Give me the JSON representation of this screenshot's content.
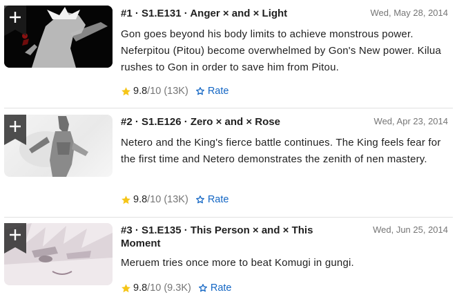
{
  "episodes": [
    {
      "title": "#1 · S1.E131 · Anger × and × Light",
      "date": "Wed, May 28, 2014",
      "plot": "Gon goes beyond his body limits to achieve monstrous power. Neferpitou (Pitou) become overwhelmed by Gon's New power. Kilua rushes to Gon in order to save him from Pitou.",
      "rating": "9.8",
      "rating_max": "/10",
      "votes": "(13K)",
      "rate_label": "Rate",
      "add_symbol": "+"
    },
    {
      "title": "#2 · S1.E126 · Zero × and × Rose",
      "date": "Wed, Apr 23, 2014",
      "plot": "Netero and the King's fierce battle continues. The King feels fear for the first time and Netero demonstrates the zenith of nen mastery.",
      "rating": "9.8",
      "rating_max": "/10",
      "votes": "(13K)",
      "rate_label": "Rate",
      "add_symbol": "+"
    },
    {
      "title": "#3 · S1.E135 · This Person × and × This Moment",
      "date": "Wed, Jun 25, 2014",
      "plot": "Meruem tries once more to beat Komugi in gungi.",
      "rating": "9.8",
      "rating_max": "/10",
      "votes": "(9.3K)",
      "rate_label": "Rate",
      "add_symbol": "+"
    }
  ],
  "icons": {
    "star": "star-icon",
    "rate": "star-outline-icon",
    "add": "plus-icon"
  },
  "colors": {
    "accent_blue": "#1366c4",
    "star_gold": "#f5c518",
    "muted_text": "#757575",
    "ribbon": "#1f1f1f"
  }
}
